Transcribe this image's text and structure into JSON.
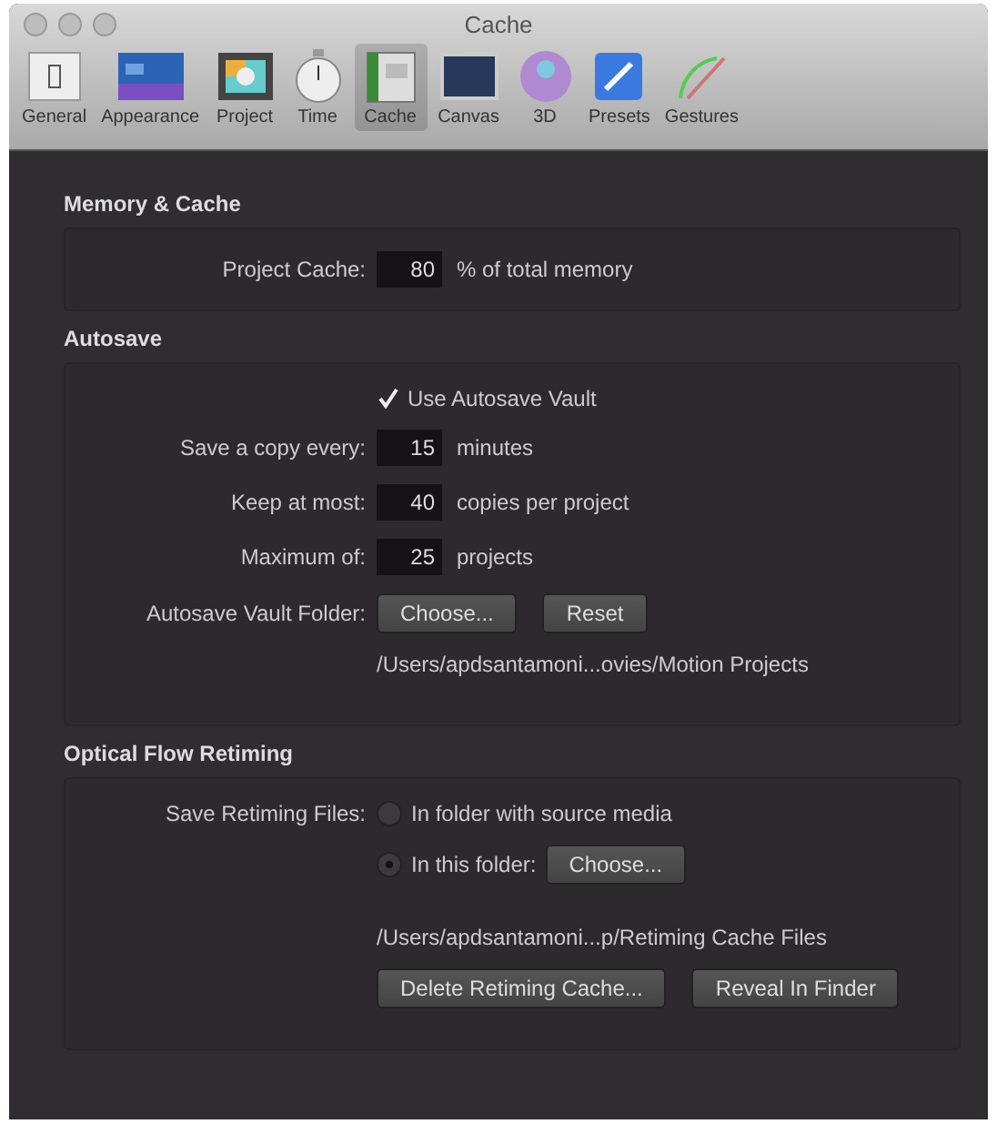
{
  "window": {
    "title": "Cache"
  },
  "tabs": [
    {
      "label": "General",
      "selected": false
    },
    {
      "label": "Appearance",
      "selected": false
    },
    {
      "label": "Project",
      "selected": false
    },
    {
      "label": "Time",
      "selected": false
    },
    {
      "label": "Cache",
      "selected": true
    },
    {
      "label": "Canvas",
      "selected": false
    },
    {
      "label": "3D",
      "selected": false
    },
    {
      "label": "Presets",
      "selected": false
    },
    {
      "label": "Gestures",
      "selected": false
    }
  ],
  "memory": {
    "title": "Memory & Cache",
    "label": "Project Cache:",
    "value": "80",
    "unit": "% of total memory"
  },
  "autosave": {
    "title": "Autosave",
    "vault": {
      "label": "Use Autosave Vault",
      "checked": true
    },
    "fields": [
      {
        "label": "Save a copy every:",
        "value": "15",
        "unit": "minutes"
      },
      {
        "label": "Keep at most:",
        "value": "40",
        "unit": "copies per project"
      },
      {
        "label": "Maximum of:",
        "value": "25",
        "unit": "projects"
      }
    ],
    "folder_label": "Autosave Vault Folder:",
    "choose": "Choose...",
    "reset": "Reset",
    "path": "/Users/apdsantamoni...ovies/Motion Projects"
  },
  "retiming": {
    "title": "Optical Flow Retiming",
    "label": "Save Retiming Files:",
    "options": [
      {
        "label": "In folder with source media",
        "selected": false
      },
      {
        "label": "In this folder:",
        "selected": true
      }
    ],
    "choose": "Choose...",
    "path": "/Users/apdsantamoni...p/Retiming Cache Files",
    "delete": "Delete Retiming Cache...",
    "reveal": "Reveal In Finder"
  }
}
